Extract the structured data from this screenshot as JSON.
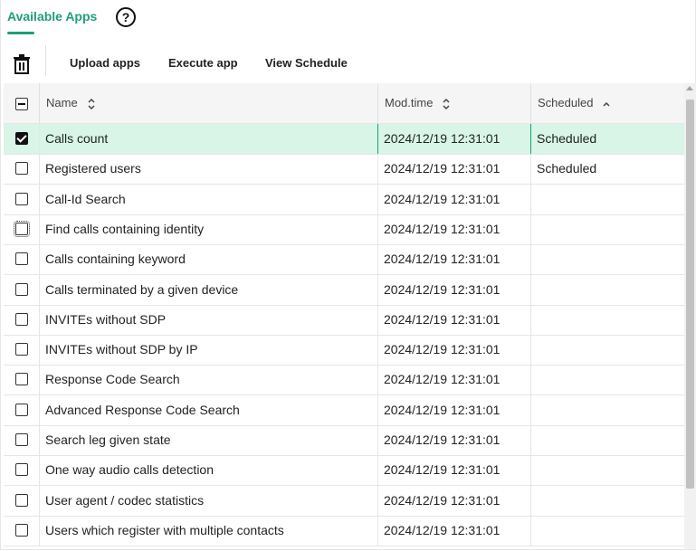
{
  "header": {
    "tab_title": "Available Apps",
    "help_symbol": "?"
  },
  "toolbar": {
    "delete_icon": "trash-icon",
    "buttons": [
      "Upload apps",
      "Execute app",
      "View Schedule"
    ]
  },
  "table": {
    "columns": [
      "Name",
      "Mod.time",
      "Scheduled"
    ],
    "name_sort": "sortable",
    "modtime_sort": "sortable",
    "scheduled_sort": "ascending",
    "rows": [
      {
        "name": "Calls count",
        "mod_time": "2024/12/19 12:31:01",
        "scheduled": "Scheduled",
        "checked": true
      },
      {
        "name": "Registered users",
        "mod_time": "2024/12/19 12:31:01",
        "scheduled": "Scheduled",
        "checked": false
      },
      {
        "name": "Call-Id Search",
        "mod_time": "2024/12/19 12:31:01",
        "scheduled": "",
        "checked": false
      },
      {
        "name": "Find calls containing identity",
        "mod_time": "2024/12/19 12:31:01",
        "scheduled": "",
        "checked": false
      },
      {
        "name": "Calls containing keyword",
        "mod_time": "2024/12/19 12:31:01",
        "scheduled": "",
        "checked": false
      },
      {
        "name": "Calls terminated by a given device",
        "mod_time": "2024/12/19 12:31:01",
        "scheduled": "",
        "checked": false
      },
      {
        "name": "INVITEs without SDP",
        "mod_time": "2024/12/19 12:31:01",
        "scheduled": "",
        "checked": false
      },
      {
        "name": "INVITEs without SDP by IP",
        "mod_time": "2024/12/19 12:31:01",
        "scheduled": "",
        "checked": false
      },
      {
        "name": "Response Code Search",
        "mod_time": "2024/12/19 12:31:01",
        "scheduled": "",
        "checked": false
      },
      {
        "name": "Advanced Response Code Search",
        "mod_time": "2024/12/19 12:31:01",
        "scheduled": "",
        "checked": false
      },
      {
        "name": "Search leg given state",
        "mod_time": "2024/12/19 12:31:01",
        "scheduled": "",
        "checked": false
      },
      {
        "name": "One way audio calls detection",
        "mod_time": "2024/12/19 12:31:01",
        "scheduled": "",
        "checked": false
      },
      {
        "name": "User agent / codec statistics",
        "mod_time": "2024/12/19 12:31:01",
        "scheduled": "",
        "checked": false
      },
      {
        "name": "Users which register with multiple contacts",
        "mod_time": "2024/12/19 12:31:01",
        "scheduled": "",
        "checked": false
      }
    ]
  },
  "colors": {
    "accent": "#1f9e7a",
    "selected_row": "#d8f5e8"
  }
}
